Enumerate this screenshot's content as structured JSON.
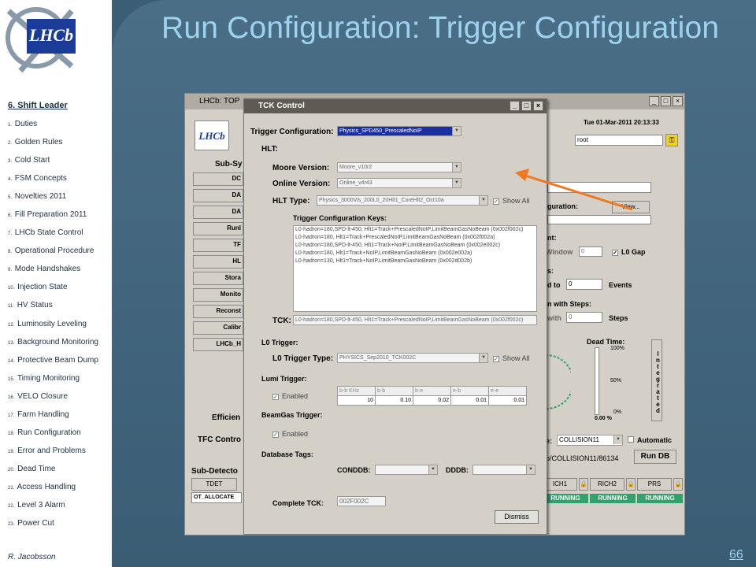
{
  "slide": {
    "title": "Run Configuration: Trigger Configuration",
    "page_number": "66",
    "author": "R. Jacobsson",
    "accent_color": "#9ed3ef",
    "logo_text": "LHCb"
  },
  "nav": {
    "title": "6. Shift Leader",
    "items": [
      {
        "num": "1.",
        "label": "Duties"
      },
      {
        "num": "2.",
        "label": "Golden Rules"
      },
      {
        "num": "3.",
        "label": "Cold Start"
      },
      {
        "num": "4.",
        "label": "FSM Concepts"
      },
      {
        "num": "5.",
        "label": "Novelties 2011"
      },
      {
        "num": "6.",
        "label": "Fill Preparation 2011"
      },
      {
        "num": "7.",
        "label": "LHCb State Control"
      },
      {
        "num": "8.",
        "label": "Operational Procedure"
      },
      {
        "num": "9.",
        "label": "Mode Handshakes"
      },
      {
        "num": "10.",
        "label": "Injection State"
      },
      {
        "num": "11.",
        "label": "HV Status"
      },
      {
        "num": "12.",
        "label": "Luminosity Leveling"
      },
      {
        "num": "13.",
        "label": "Background Monitoring"
      },
      {
        "num": "14.",
        "label": "Protective Beam Dump"
      },
      {
        "num": "15.",
        "label": "Timing Monitoring"
      },
      {
        "num": "16.",
        "label": "VELO Closure"
      },
      {
        "num": "17.",
        "label": "Farm Handling"
      },
      {
        "num": "18.",
        "label": "Run Configuration"
      },
      {
        "num": "19.",
        "label": "Error and Problems"
      },
      {
        "num": "20.",
        "label": "Dead Time"
      },
      {
        "num": "21.",
        "label": "Access Handling"
      },
      {
        "num": "22.",
        "label": "Level 3 Alarm"
      },
      {
        "num": "23.",
        "label": "Power Cut"
      }
    ]
  },
  "top_window": {
    "title": "LHCb: TOP",
    "datetime": "Tue 01-Mar-2011   20:13:33",
    "user": "root",
    "logo": "LHCb",
    "subsystems_label": "Sub-Sy",
    "subsystem_buttons": [
      "DC",
      "DA",
      "DA",
      "Runl",
      "TF",
      "HL",
      "Stora",
      "Monito",
      "Reconst",
      "Calibr",
      "LHCb_H"
    ],
    "configuration_label": "guration:",
    "view_button": "View...",
    "nt_label": "nt:",
    "window_label": "Window",
    "window_value": "0",
    "l0gap_label": "L0 Gap",
    "s_label": "s:",
    "dto_label": "d to",
    "events_value": "0",
    "events_label": "Events",
    "steps_header": "n with Steps:",
    "with_label": "with",
    "steps_value": "0",
    "steps_label": "Steps",
    "dead_time_label": "Dead Time:",
    "dt_100": "100%",
    "dt_50": "50%",
    "dt_0": "0%",
    "dt_value": "0.00",
    "dt_unit": "%",
    "integrated_label": "Integrated",
    "efficiency_label": "Efficien",
    "tfc_control_label": "TFC Contro",
    "activity_label": "e:",
    "activity_value": "COLLISION11",
    "automatic_label": "Automatic",
    "run_db_path": "b/COLLISION11/86134",
    "run_db_button": "Run DB",
    "subdetectors_label": "Sub-Detecto",
    "tdet_label": "TDET",
    "tdet_state": "OT_ALLOCATE",
    "detectors": [
      {
        "name": "ICH1",
        "state": "RUNNING"
      },
      {
        "name": "RICH2",
        "state": "RUNNING"
      },
      {
        "name": "PRS",
        "state": "RUNNING"
      }
    ]
  },
  "tck": {
    "window_title": "TCK Control",
    "trigger_configuration_label": "Trigger Configuration:",
    "trigger_configuration_value": "Physics_SPD450_PrescaledNoIP",
    "hlt_label": "HLT:",
    "moore_label": "Moore Version:",
    "moore_value": "Moore_v10r2",
    "online_label": "Online Version:",
    "online_value": "Online_v4r43",
    "hlt_type_label": "HLT Type:",
    "hlt_type_value": "Physics_3000Vis_200L0_20Hlt1_CoreHlt2_Oct10a",
    "show_all_label": "Show All",
    "keys_label": "Trigger Configuration Keys:",
    "keys": [
      "L0-hadron=180,SPD-lt-450, Hlt1=Track+PrescaledNoIP,LimitBeamGasNoBeam (0x002f002c)",
      "L0-hadron=180, Hlt1=Track+PrescaledNoIP,LimitBeamGasNoBeam (0x002f002a)",
      "L0-hadron=180,SPD-lt-450, Hlt1=Track+NoIP,LimitBeamGasNoBeam (0x002e002c)",
      "L0-hadron=180, Hlt1=Track+NoIP,LimitBeamGasNoBeam (0x002e002a)",
      "L0-hadron=130, Hlt1=Track+NoIP,LimitBeamGasNoBeam (0x002d002b)"
    ],
    "tck_label": "TCK:",
    "tck_value": "L0-hadron=180,SPD-lt-450, Hlt1=Track+PrescaledNoIP,LimitBeamGasNoBeam (0x002f002c)",
    "l0_trigger_label": "L0 Trigger:",
    "l0_type_label": "L0 Trigger Type:",
    "l0_type_value": "PHYSICS_Sep2010_TCK002C",
    "lumi_label": "Lumi Trigger:",
    "enabled_label": "Enabled",
    "lumi_headers": [
      "b-b KHz",
      "b-b",
      "b-e",
      "e-b",
      "e-e"
    ],
    "lumi_values": [
      "10",
      "0.10",
      "0.02",
      "0.01",
      "0.01"
    ],
    "beamgas_label": "BeamGas Trigger:",
    "db_tags_label": "Database Tags:",
    "conddb_label": "CONDDB:",
    "dddb_label": "DDDB:",
    "complete_tck_label": "Complete TCK:",
    "complete_tck_value": "002F002C",
    "dismiss_label": "Dismiss"
  },
  "arrow_color": "#f07820"
}
